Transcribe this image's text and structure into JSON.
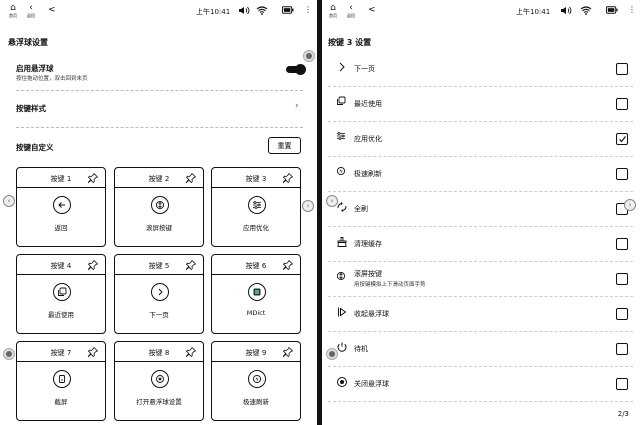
{
  "status_bar": {
    "home_label": "首页",
    "back_label": "返回",
    "time": "上午10:41"
  },
  "left": {
    "title": "悬浮球设置",
    "enable": {
      "label": "启用悬浮球",
      "sub": "按住拖动位置，双击回到末页",
      "on": true
    },
    "style_label": "按键样式",
    "custom_label": "按键自定义",
    "reset_label": "重置",
    "keys": [
      {
        "name": "按键 1",
        "label": "返回",
        "icon": "back-arrow-icon"
      },
      {
        "name": "按键 2",
        "label": "滚屏按键",
        "icon": "scroll-icon"
      },
      {
        "name": "按键 3",
        "label": "应用优化",
        "icon": "optimize-icon"
      },
      {
        "name": "按键 4",
        "label": "最近使用",
        "icon": "recent-icon"
      },
      {
        "name": "按键 5",
        "label": "下一页",
        "icon": "next-page-icon"
      },
      {
        "name": "按键 6",
        "label": "MDict",
        "icon": "mdict-icon"
      },
      {
        "name": "按键 7",
        "label": "截屏",
        "icon": "screenshot-icon"
      },
      {
        "name": "按键 8",
        "label": "打开悬浮球设置",
        "icon": "float-settings-icon"
      },
      {
        "name": "按键 9",
        "label": "极速刷新",
        "icon": "fast-refresh-icon"
      }
    ]
  },
  "right": {
    "title": "按键 3 设置",
    "options": [
      {
        "label": "下一页",
        "sub": "",
        "checked": false,
        "icon": "chevron-right-icon"
      },
      {
        "label": "最近使用",
        "sub": "",
        "checked": false,
        "icon": "recent-icon"
      },
      {
        "label": "应用优化",
        "sub": "",
        "checked": true,
        "icon": "optimize-icon"
      },
      {
        "label": "极速刷新",
        "sub": "",
        "checked": false,
        "icon": "fast-refresh-icon"
      },
      {
        "label": "全刷",
        "sub": "",
        "checked": false,
        "icon": "full-refresh-icon"
      },
      {
        "label": "清理缓存",
        "sub": "",
        "checked": false,
        "icon": "clear-cache-icon"
      },
      {
        "label": "滚屏按键",
        "sub": "用按键模拟上下滑动页面手势",
        "checked": false,
        "icon": "scroll-icon"
      },
      {
        "label": "收起悬浮球",
        "sub": "",
        "checked": false,
        "icon": "collapse-icon"
      },
      {
        "label": "待机",
        "sub": "",
        "checked": false,
        "icon": "standby-icon"
      },
      {
        "label": "关闭悬浮球",
        "sub": "",
        "checked": false,
        "icon": "close-float-icon"
      }
    ],
    "page": "2/3"
  }
}
